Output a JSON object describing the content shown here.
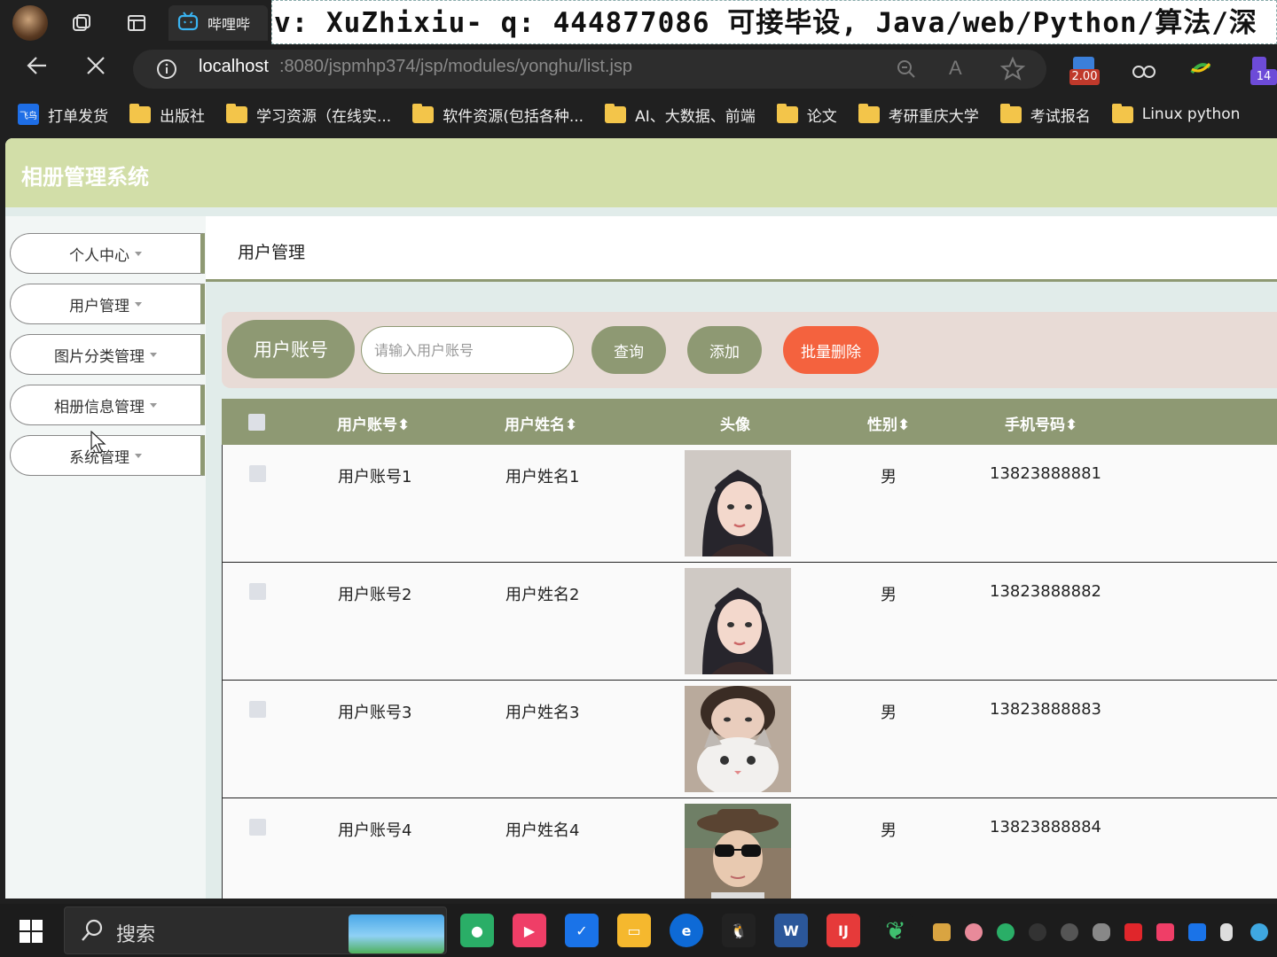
{
  "browser": {
    "active_tab_title": "哔哩哔",
    "banner_text": "v: XuZhixiu-  q: 444877086  可接毕设, Java/web/Python/算法/深",
    "url_host": "localhost",
    "url_path": ":8080/jspmhp374/jsp/modules/yonghu/list.jsp",
    "ext_badge_1": "2.00",
    "ext_badge_2": "14",
    "bookmarks": [
      "打单发货",
      "出版社",
      "学习资源（在线实...",
      "软件资源(包括各种...",
      "AI、大数据、前端",
      "论文",
      "考研重庆大学",
      "考试报名",
      "Linux python"
    ]
  },
  "app": {
    "title": "相册管理系统",
    "sidebar": [
      "个人中心",
      "用户管理",
      "图片分类管理",
      "相册信息管理",
      "系统管理"
    ],
    "breadcrumb": "用户管理",
    "search": {
      "label": "用户账号",
      "placeholder": "请输入用户账号",
      "query_label": "查询",
      "add_label": "添加",
      "batch_delete_label": "批量删除"
    },
    "table": {
      "headers": [
        "用户账号",
        "用户姓名",
        "头像",
        "性别",
        "手机号码"
      ],
      "sort_icon": "sort-icon",
      "rows": [
        {
          "account": "用户账号1",
          "name": "用户姓名1",
          "gender": "男",
          "phone": "13823888881"
        },
        {
          "account": "用户账号2",
          "name": "用户姓名2",
          "gender": "男",
          "phone": "13823888882"
        },
        {
          "account": "用户账号3",
          "name": "用户姓名3",
          "gender": "男",
          "phone": "13823888883"
        },
        {
          "account": "用户账号4",
          "name": "用户姓名4",
          "gender": "男",
          "phone": "13823888884"
        }
      ]
    }
  },
  "taskbar": {
    "search_text": "搜索"
  },
  "colors": {
    "header_bg": "#d2dea8",
    "accent": "#8e9973",
    "danger": "#f4623e",
    "search_bar_bg": "#e8dbd6"
  }
}
